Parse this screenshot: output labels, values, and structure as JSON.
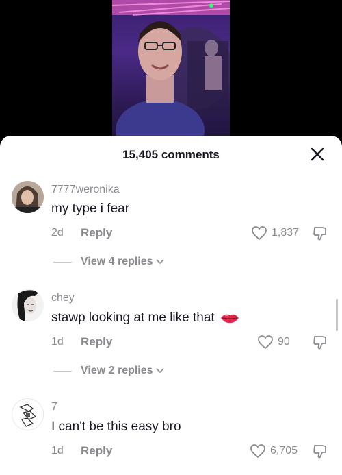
{
  "video": {
    "icon": "video-frame-person-at-party"
  },
  "header": {
    "comment_count": "15,405 comments",
    "close_icon": "close-icon"
  },
  "comments": [
    {
      "username": "7777weronika",
      "text": "my type i fear",
      "time": "2d",
      "reply_label": "Reply",
      "likes": "1,837",
      "view_replies": "View 4 replies"
    },
    {
      "username": "chey",
      "text": "stawp looking at me like that",
      "emoji": "lips-emoji",
      "time": "1d",
      "reply_label": "Reply",
      "likes": "90",
      "view_replies": "View 2 replies"
    },
    {
      "username": "7",
      "text": "I can't be this easy bro",
      "time": "1d",
      "reply_label": "Reply",
      "likes": "6,705"
    }
  ]
}
